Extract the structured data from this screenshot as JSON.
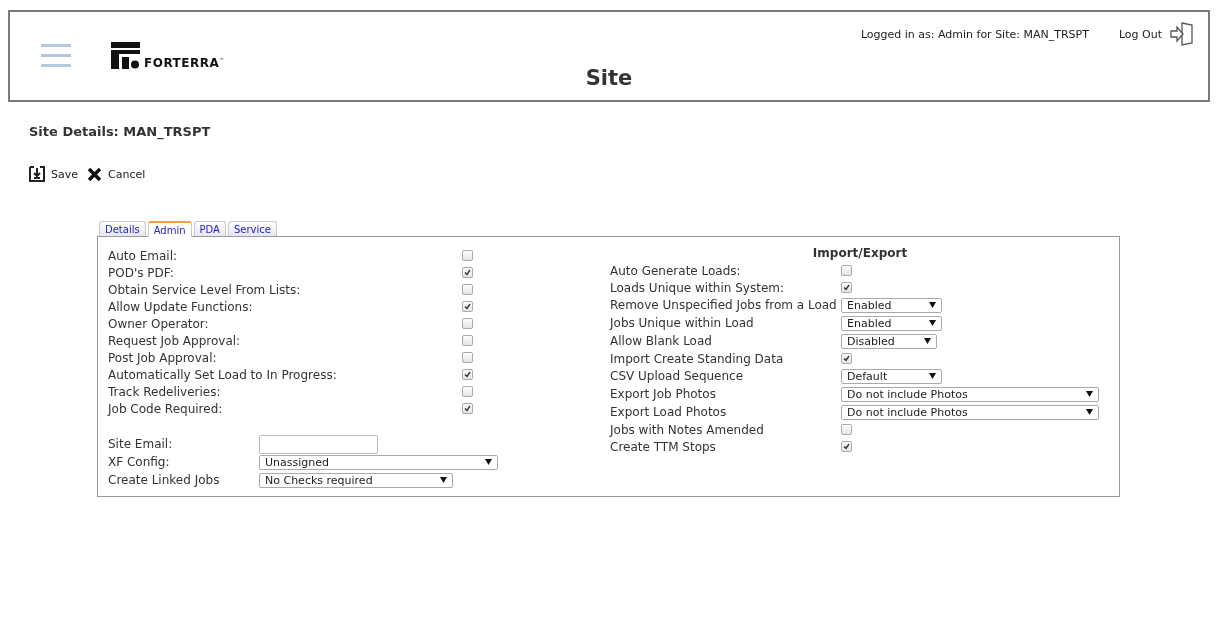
{
  "header": {
    "brand": "FORTERRA",
    "trademark": "™",
    "title": "Site",
    "login_info": "Logged in as: Admin for Site: MAN_TRSPT",
    "logout": "Log Out"
  },
  "heading": "Site Details: MAN_TRSPT",
  "actions": [
    {
      "kind": "save",
      "label": "Save"
    },
    {
      "kind": "cancel",
      "label": "Cancel"
    }
  ],
  "tabs": [
    {
      "label": "Details",
      "selected": false
    },
    {
      "label": "Admin",
      "selected": true
    },
    {
      "label": "PDA",
      "selected": false
    },
    {
      "label": "Service",
      "selected": false
    }
  ],
  "admin_options": [
    {
      "label": "Auto Email:",
      "checked": false
    },
    {
      "label": "POD's PDF:",
      "checked": true
    },
    {
      "label": "Obtain Service Level From Lists:",
      "checked": false
    },
    {
      "label": "Allow Update Functions:",
      "checked": true
    },
    {
      "label": "Owner Operator:",
      "checked": false
    },
    {
      "label": "Request Job Approval:",
      "checked": false
    },
    {
      "label": "Post Job Approval:",
      "checked": false
    },
    {
      "label": "Automatically Set Load to In Progress:",
      "checked": true
    },
    {
      "label": "Track Redeliveries:",
      "checked": false
    },
    {
      "label": "Job Code Required:",
      "checked": true
    }
  ],
  "site_fields": [
    {
      "kind": "input",
      "label": "Site Email:"
    },
    {
      "kind": "select",
      "label": "XF Config:",
      "value": "Unassigned"
    },
    {
      "kind": "select",
      "label": "Create Linked Jobs",
      "value": "No Checks required"
    }
  ],
  "import_export": {
    "title": "Import/Export",
    "rows": [
      {
        "kind": "checkbox",
        "label": "Auto Generate Loads:",
        "checked": false
      },
      {
        "kind": "checkbox",
        "label": "Loads Unique within System:",
        "checked": true
      },
      {
        "kind": "select",
        "label": "Remove Unspecified Jobs from a Load",
        "value": "Enabled"
      },
      {
        "kind": "select",
        "label": "Jobs Unique within Load",
        "value": "Enabled"
      },
      {
        "kind": "select",
        "label": "Allow Blank Load",
        "value": "Disabled"
      },
      {
        "kind": "checkbox",
        "label": "Import Create Standing Data",
        "checked": true
      },
      {
        "kind": "select",
        "label": "CSV Upload Sequence",
        "value": "Default"
      },
      {
        "kind": "select",
        "label": "Export Job Photos",
        "value": "Do not include Photos"
      },
      {
        "kind": "select",
        "label": "Export Load Photos",
        "value": "Do not include Photos"
      },
      {
        "kind": "checkbox",
        "label": "Jobs with Notes Amended",
        "checked": false
      },
      {
        "kind": "checkbox",
        "label": "Create TTM Stops",
        "checked": true
      }
    ]
  }
}
